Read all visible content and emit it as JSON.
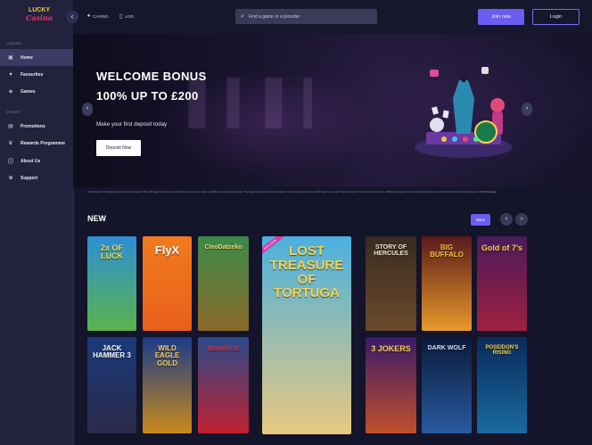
{
  "logo": {
    "line1": "LUCKY",
    "line2": "Casino"
  },
  "sidebar": {
    "section_casino": "CASINO",
    "section_other": "OTHER",
    "items": [
      {
        "label": "Home",
        "icon": "home-icon",
        "glyph": "▣",
        "active": true
      },
      {
        "label": "Favourites",
        "icon": "heart-icon",
        "glyph": "♥",
        "active": false
      },
      {
        "label": "Games",
        "icon": "gamepad-icon",
        "glyph": "◈",
        "active": false
      },
      {
        "label": "Promotions",
        "icon": "gift-icon",
        "glyph": "▤",
        "active": false
      },
      {
        "label": "Rewards Programme",
        "icon": "trophy-icon",
        "glyph": "♛",
        "active": false
      },
      {
        "label": "About Us",
        "icon": "info-icon",
        "glyph": "ⓘ",
        "active": false
      },
      {
        "label": "Support",
        "icon": "support-icon",
        "glyph": "⊕",
        "active": false
      }
    ]
  },
  "topbar": {
    "breadcrumbs": [
      {
        "label": "CASINO",
        "icon": "casino-icon"
      },
      {
        "label": "LIVE",
        "icon": "live-icon"
      }
    ],
    "search_placeholder": "Find a game or a provider",
    "join_label": "Join now",
    "login_label": "Login"
  },
  "hero": {
    "line1": "WELCOME BONUS",
    "line2": "100% UP TO £200",
    "subtitle": "Make your first deposit today",
    "cta": "Deposit Now"
  },
  "terms": {
    "text": "New Players Only. Wagering occurs from real balance first. 35X wagering the bonus. Contribution may vary per game. Available on selected games only. The wagering requirement is calculated on bonus bets only. Bonus valid 30 days from receipt. Max conversion: 5 times the bonus amount. Withdrawal requests void all active/pending bonuses. Excluded Skrill and Neteller deposits.",
    "link": "Full Terms apply"
  },
  "new_section": {
    "title": "NEW",
    "more": "More",
    "badge": "EXCLUSIVE",
    "games": [
      {
        "title": "2x OF LUCK",
        "bg": "#2c8fd6",
        "bg2": "#5bb34a",
        "color": "#f5e04a"
      },
      {
        "title": "FlyX",
        "bg": "#f07a1e",
        "bg2": "#e8601a",
        "color": "#ffffff"
      },
      {
        "title": "CleoDatzeko",
        "bg": "#3c8a4a",
        "bg2": "#8a6a2a",
        "color": "#f7d770"
      },
      {
        "title": "LOST TREASURE OF TORTUGA",
        "bg": "#4ab0e0",
        "bg2": "#e8c880",
        "color": "#f6d34e"
      },
      {
        "title": "STORY OF HERCULES",
        "bg": "#3a2a22",
        "bg2": "#6a4a2a",
        "color": "#f0e6d0"
      },
      {
        "title": "BIG BUFFALO",
        "bg": "#5a1a1a",
        "bg2": "#e89a2a",
        "color": "#f0c040"
      },
      {
        "title": "Gold of 7's",
        "bg": "#4a1a5a",
        "bg2": "#a02040",
        "color": "#f6d34e"
      },
      {
        "title": "JACK HAMMER 3",
        "bg": "#1a3a7a",
        "bg2": "#2a2a4a",
        "color": "#ffffff"
      },
      {
        "title": "WILD EAGLE GOLD",
        "bg": "#1a3a8a",
        "bg2": "#c88a1a",
        "color": "#f6d34e"
      },
      {
        "title": "Maverick",
        "bg": "#2a4a8a",
        "bg2": "#c02030",
        "color": "#e83040"
      },
      {
        "title": "3 JOKERS",
        "bg": "#3a1a6a",
        "bg2": "#c0502a",
        "color": "#f6d34e"
      },
      {
        "title": "DARK WOLF",
        "bg": "#0a1a3a",
        "bg2": "#2a5aa0",
        "color": "#d0e0ff"
      },
      {
        "title": "POSEIDON'S RISING",
        "bg": "#0a2a5a",
        "bg2": "#1a6aa0",
        "color": "#f6d34e"
      }
    ]
  }
}
